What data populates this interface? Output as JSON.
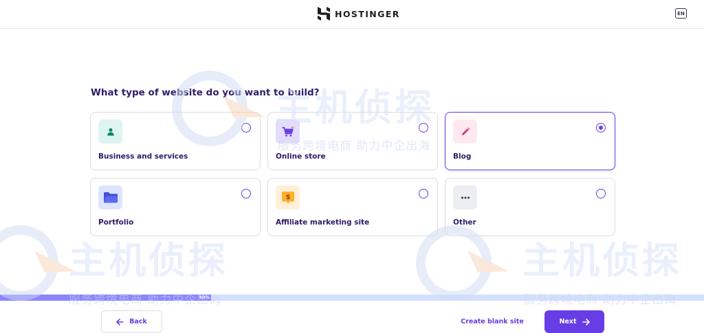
{
  "header": {
    "brand": "HOSTINGER",
    "language": "EN"
  },
  "question": "What type of website do you want to build?",
  "options": [
    {
      "label": "Business and services",
      "icon": "person-icon",
      "selected": false
    },
    {
      "label": "Online store",
      "icon": "shopping-cart-icon",
      "selected": false
    },
    {
      "label": "Blog",
      "icon": "pencil-icon",
      "selected": true
    },
    {
      "label": "Portfolio",
      "icon": "folder-icon",
      "selected": false
    },
    {
      "label": "Affiliate marketing site",
      "icon": "dollar-chat-icon",
      "selected": false
    },
    {
      "label": "Other",
      "icon": "more-dots-icon",
      "selected": false
    }
  ],
  "progress": {
    "percent": 30,
    "label": "30%"
  },
  "footer": {
    "back_label": "Back",
    "blank_label": "Create blank site",
    "next_label": "Next"
  },
  "watermark": {
    "title": "主机侦探",
    "subtitle": "服务跨境电商 助力中企出海"
  },
  "colors": {
    "accent": "#673de6",
    "text": "#2f1c6a",
    "progress_fill": "#8c85ff",
    "progress_track": "#d5dfff"
  }
}
